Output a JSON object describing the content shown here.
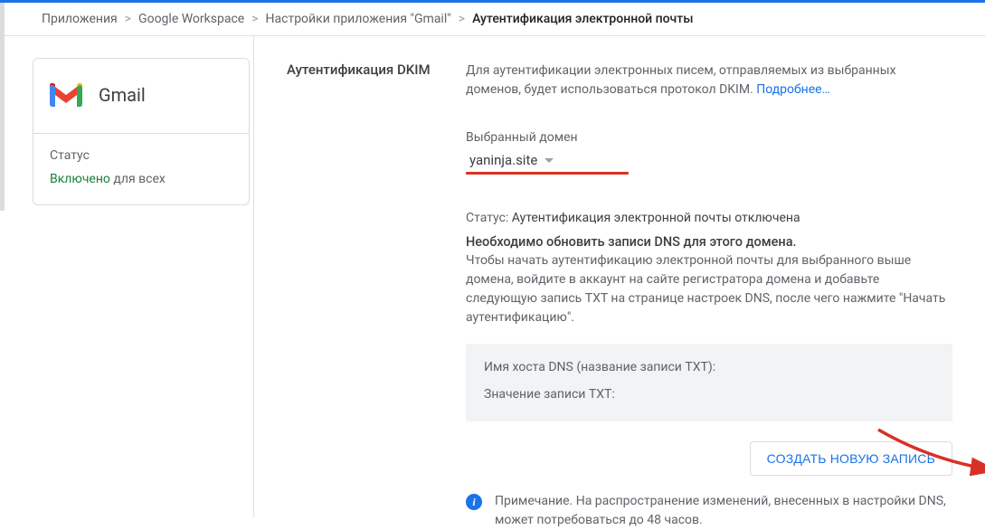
{
  "breadcrumb": {
    "items": [
      "Приложения",
      "Google Workspace",
      "Настройки приложения \"Gmail\""
    ],
    "current": "Аутентификация электронной почты"
  },
  "sidebar": {
    "app_name": "Gmail",
    "status_label": "Статус",
    "status_value": "Включено",
    "status_suffix": "для всех"
  },
  "section": {
    "title": "Аутентификация DKIM",
    "description": "Для аутентификации электронных писем, отправляемых из выбранных доменов, будет использоваться протокол DKIM. ",
    "learn_more": "Подробнее…"
  },
  "domain": {
    "label": "Выбранный домен",
    "selected": "yaninja.site"
  },
  "status": {
    "prefix": "Статус: ",
    "value": "Аутентификация электронной почты отключена",
    "headline": "Необходимо обновить записи DNS для этого домена.",
    "paragraph": "Чтобы начать аутентификацию электронной почты для выбранного выше домена, войдите в аккаунт на сайте регистратора домена и добавьте следующую запись TXT на странице настроек DNS, после чего нажмите \"Начать аутентификацию\"."
  },
  "dns": {
    "host_label": "Имя хоста DNS (название записи TXT):",
    "value_label": "Значение записи TXT:"
  },
  "button": {
    "create": "СОЗДАТЬ НОВУЮ ЗАПИСЬ"
  },
  "note": {
    "text": "Примечание. На распространение изменений, внесенных в настройки DNS, может потребоваться до 48 часов."
  }
}
